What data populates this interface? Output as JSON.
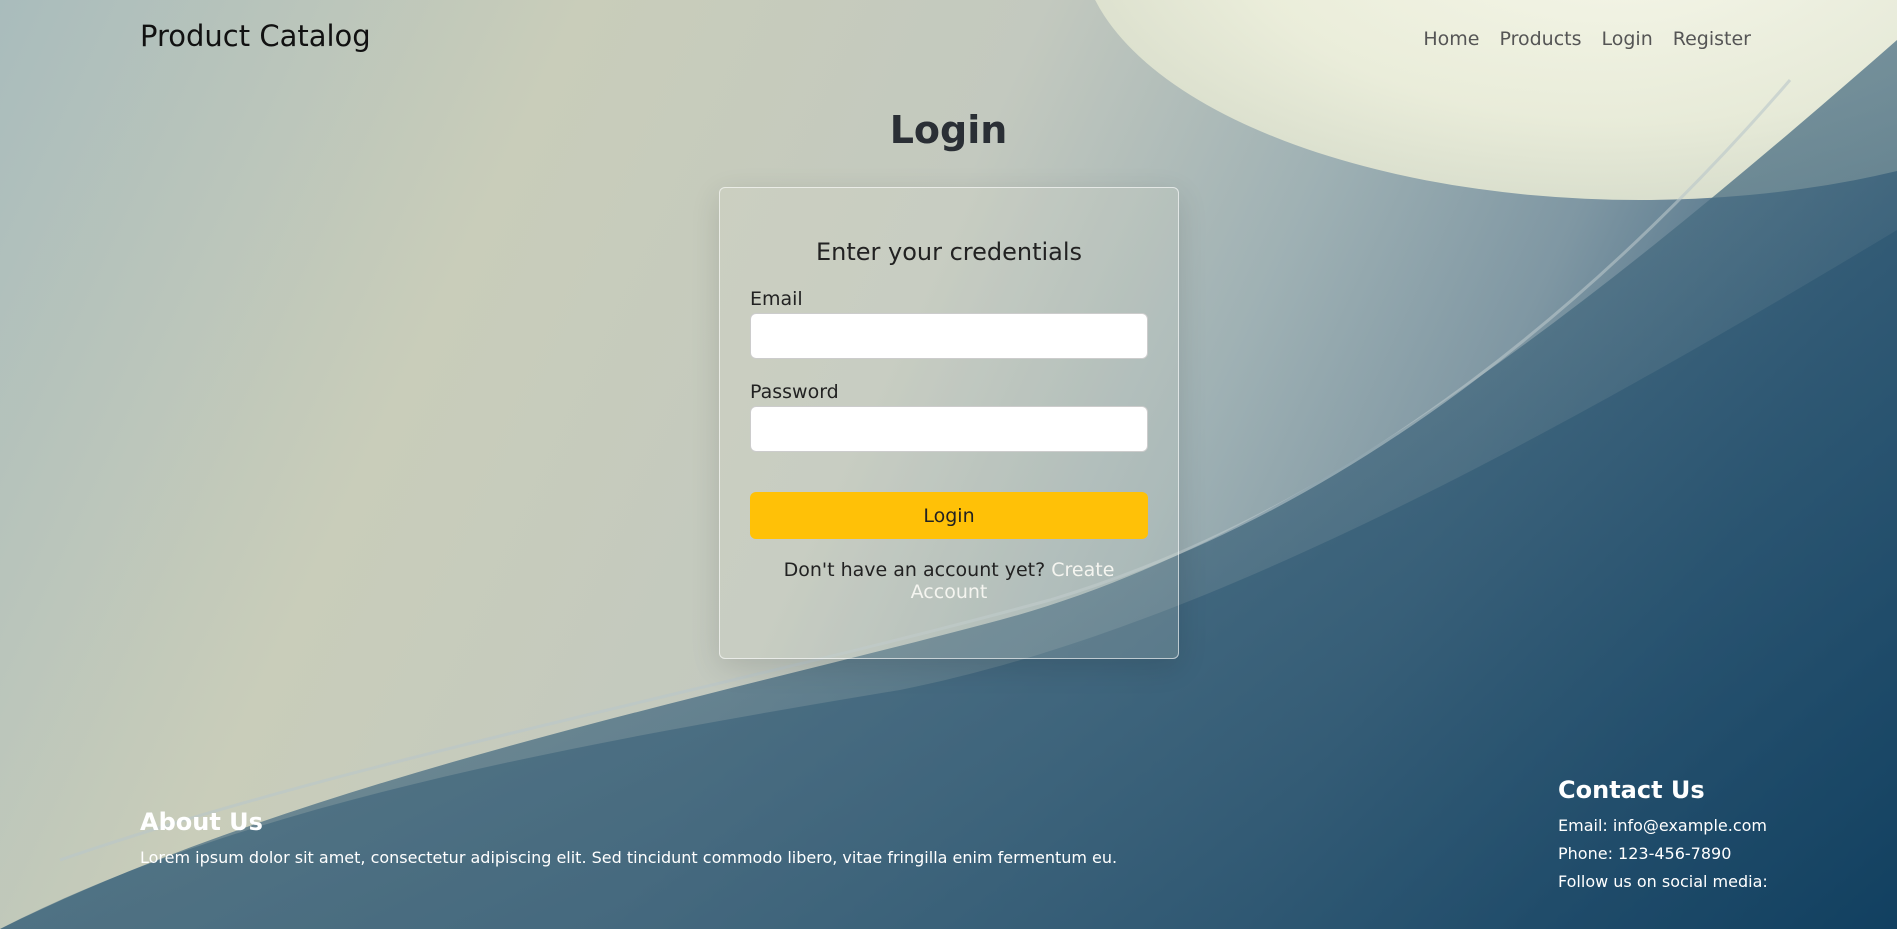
{
  "brand": "Product Catalog",
  "nav": {
    "items": [
      {
        "label": "Home"
      },
      {
        "label": "Products"
      },
      {
        "label": "Login"
      },
      {
        "label": "Register"
      }
    ]
  },
  "page_title": "Login",
  "form": {
    "heading": "Enter your credentials",
    "email_label": "Email",
    "email_value": "",
    "password_label": "Password",
    "password_value": "",
    "submit_label": "Login",
    "signup_prompt": "Don't have an account yet?",
    "signup_link": "Create Account"
  },
  "footer": {
    "about_title": "About Us",
    "about_text": "Lorem ipsum dolor sit amet, consectetur adipiscing elit. Sed tincidunt commodo libero, vitae fringilla enim fermentum eu.",
    "contact_title": "Contact Us",
    "contact_email": "Email: info@example.com",
    "contact_phone": "Phone: 123-456-7890",
    "contact_social": "Follow us on social media:"
  },
  "colors": {
    "accent": "#ffc107",
    "background_dark": "#0e3d5e",
    "background_light": "#c9cdba"
  },
  "background_image": "abstract-architecture-curves"
}
